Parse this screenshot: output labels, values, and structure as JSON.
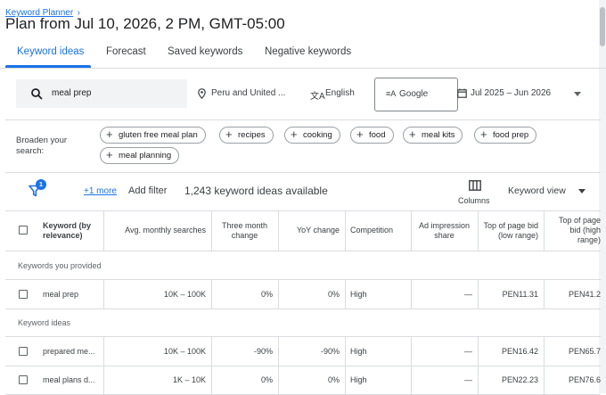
{
  "breadcrumb": {
    "label": "Keyword Planner",
    "chevron": "›"
  },
  "title": "Plan from Jul 10, 2026, 2 PM, GMT-05:00",
  "tabs": [
    "Keyword ideas",
    "Forecast",
    "Saved keywords",
    "Negative keywords"
  ],
  "filters": {
    "search_value": "meal prep",
    "location": "Peru and United ...",
    "language": "English",
    "network": "Google",
    "date_range": "Jul 2025 – Jun 2026"
  },
  "broaden": {
    "label": "Broaden your search:",
    "chips": [
      "gluten free meal plan",
      "recipes",
      "cooking",
      "food",
      "meal kits",
      "food prep",
      "meal planning"
    ]
  },
  "toolbar": {
    "filter_badge": "1",
    "more_filters": "+1 more",
    "add_filter": "Add filter",
    "count_text": "1,243 keyword ideas available",
    "columns_label": "Columns",
    "view_label": "Keyword view"
  },
  "table": {
    "headers": {
      "keyword": "Keyword (by relevance)",
      "avg": "Avg. monthly searches",
      "three_month": "Three month change",
      "yoy": "YoY change",
      "competition": "Competition",
      "ad_share": "Ad impression share",
      "bid_low": "Top of page bid (low range)",
      "bid_high": "Top of page bid (high range)"
    },
    "section_provided": "Keywords you provided",
    "section_ideas": "Keyword ideas",
    "provided_rows": [
      {
        "keyword": "meal prep",
        "avg": "10K – 100K",
        "three": "0%",
        "yoy": "0%",
        "comp": "High",
        "share": "—",
        "low": "PEN11.31",
        "high": "PEN41.2"
      }
    ],
    "idea_rows": [
      {
        "keyword": "prepared me...",
        "avg": "10K – 100K",
        "three": "-90%",
        "yoy": "-90%",
        "comp": "High",
        "share": "—",
        "low": "PEN16.42",
        "high": "PEN65.7"
      },
      {
        "keyword": "meal plans d...",
        "avg": "1K – 10K",
        "three": "0%",
        "yoy": "0%",
        "comp": "High",
        "share": "—",
        "low": "PEN22.23",
        "high": "PEN76.6"
      }
    ]
  },
  "colors": {
    "accent": "#1a73e8",
    "border": "#dadce0"
  }
}
